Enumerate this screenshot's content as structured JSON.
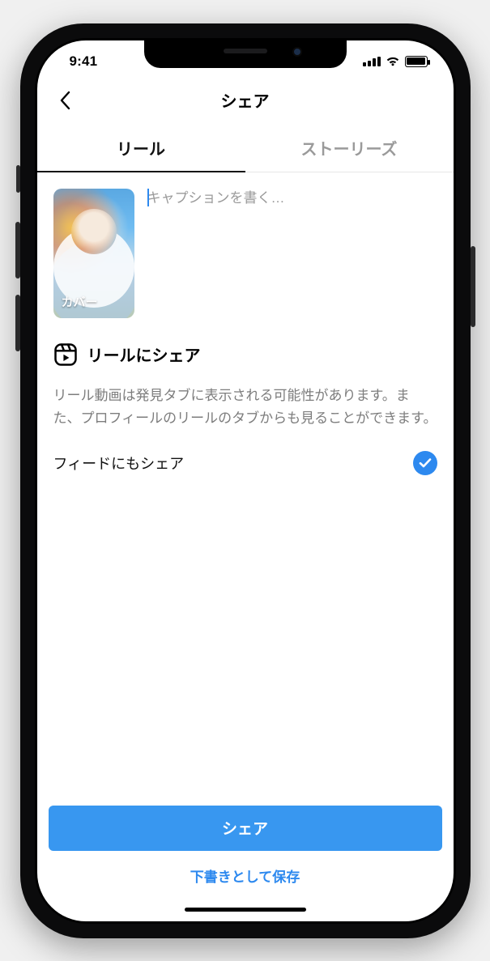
{
  "status": {
    "time": "9:41"
  },
  "header": {
    "title": "シェア"
  },
  "tabs": {
    "reels": "リール",
    "stories": "ストーリーズ",
    "active": "reels"
  },
  "compose": {
    "cover_label": "カバー",
    "caption_placeholder": "キャプションを書く…"
  },
  "share_section": {
    "title": "リールにシェア",
    "description": "リール動画は発見タブに表示される可能性があります。また、プロフィールのリールのタブからも見ることができます。",
    "feed_toggle_label": "フィードにもシェア",
    "feed_toggle_checked": true
  },
  "footer": {
    "share_button": "シェア",
    "save_draft": "下書きとして保存"
  }
}
